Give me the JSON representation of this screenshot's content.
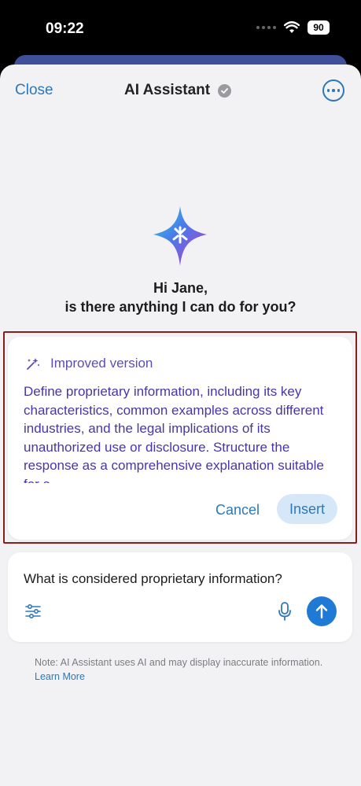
{
  "status_bar": {
    "time": "09:22",
    "battery": "90"
  },
  "header": {
    "close_label": "Close",
    "title": "AI Assistant"
  },
  "greeting": {
    "line1": "Hi Jane,",
    "line2": "is there anything I can do for you?"
  },
  "improved": {
    "heading": "Improved version",
    "body": "Define proprietary information, including its key characteristics, common examples across different industries, and the legal implications of its unauthorized use or disclosure. Structure the response as a comprehensive explanation suitable for a",
    "cancel_label": "Cancel",
    "insert_label": "Insert"
  },
  "input": {
    "value": "What is considered proprietary information?"
  },
  "note": {
    "text": "Note: AI Assistant uses AI and may display inaccurate information.",
    "link": "Learn More"
  },
  "colors": {
    "accent": "#2e78b8",
    "improved_text": "#4a35a6",
    "send_button": "#1f7ad6"
  }
}
